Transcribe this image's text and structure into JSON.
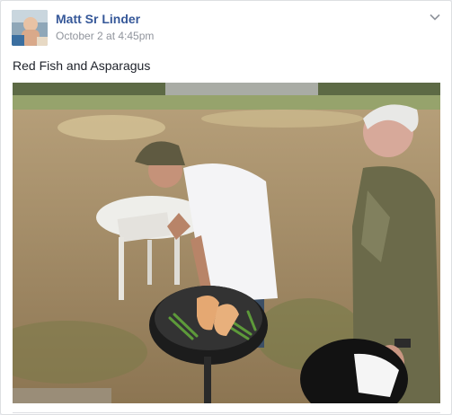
{
  "post": {
    "author": "Matt Sr Linder",
    "timestamp": "October 2 at 4:45pm",
    "caption": "Red Fish and Asparagus",
    "menu_icon": "chevron-down-icon",
    "photo_description_icon": "photo"
  },
  "colors": {
    "author_link": "#365899",
    "meta_text": "#90949c",
    "body_text": "#1d2129"
  }
}
